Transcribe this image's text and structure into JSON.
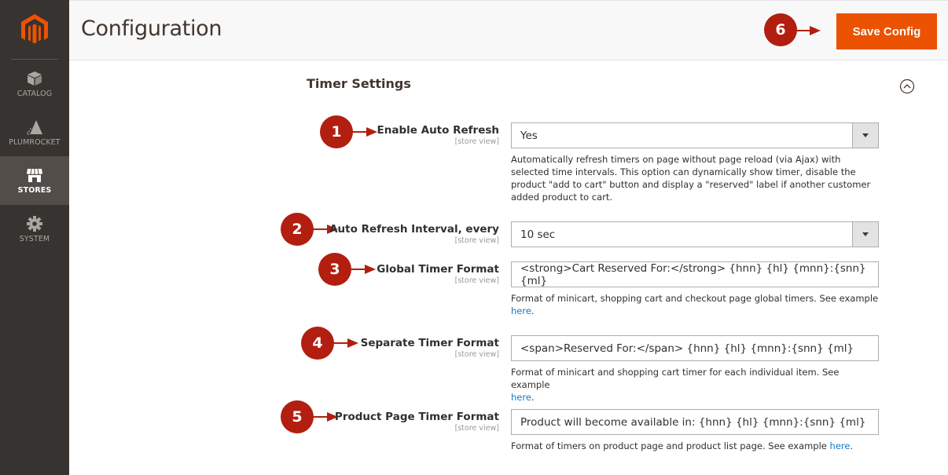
{
  "sidebar": {
    "logo": "magento-logo",
    "items": [
      {
        "label": "CATALOG",
        "icon": "box-icon",
        "active": false
      },
      {
        "label": "PLUMROCKET",
        "icon": "plumrocket-icon",
        "active": false
      },
      {
        "label": "STORES",
        "icon": "store-icon",
        "active": true
      },
      {
        "label": "SYSTEM",
        "icon": "gear-icon",
        "active": false
      }
    ]
  },
  "header": {
    "title": "Configuration",
    "save_label": "Save Config"
  },
  "section": {
    "title": "Timer Settings",
    "collapse_icon": "collapse-up-icon"
  },
  "colors": {
    "accent": "#eb5202",
    "annotation": "#b21e0f",
    "link": "#1979c3",
    "sidebar": "#373330"
  },
  "fields": [
    {
      "label": "Enable Auto Refresh",
      "scope": "[store view]",
      "type": "select",
      "value": "Yes",
      "note": "Automatically refresh timers on page without page reload (via Ajax) with selected time intervals. This option can dynamically show timer, disable the product \"add to cart\" button and display a \"reserved\" label if another customer added product to cart."
    },
    {
      "label": "Auto Refresh Interval, every",
      "scope": "[store view]",
      "type": "select",
      "value": "10 sec"
    },
    {
      "label": "Global Timer Format",
      "scope": "[store view]",
      "type": "text",
      "value": "<strong>Cart Reserved For:</strong> {hnn} {hl} {mnn}:{snn} {ml}",
      "note": "Format of minicart, shopping cart and checkout page global timers. See example ",
      "note_link": "here",
      "note_end": "."
    },
    {
      "label": "Separate Timer Format",
      "scope": "[store view]",
      "type": "text",
      "value": "<span>Reserved For:</span> {hnn} {hl} {mnn}:{snn} {ml}",
      "note": "Format of minicart and shopping cart timer for each individual item. See example ",
      "note_link": "here",
      "note_end": "."
    },
    {
      "label": "Product Page Timer Format",
      "scope": "[store view]",
      "type": "text",
      "value": "Product will become available in: {hnn} {hl} {mnn}:{snn} {ml}",
      "note": "Format of timers on product page and product list page. See example ",
      "note_link": "here",
      "note_end": "."
    }
  ],
  "annotations": [
    "1",
    "2",
    "3",
    "4",
    "5",
    "6"
  ]
}
